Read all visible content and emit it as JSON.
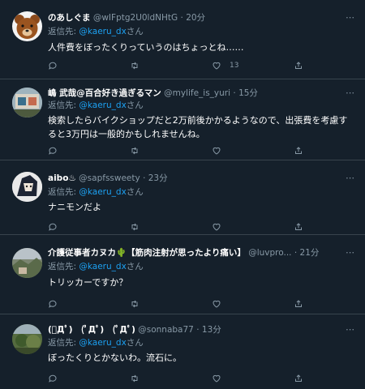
{
  "reply_label": "返信先:",
  "reply_suffix": "さん",
  "more_icon": "⋯",
  "colors": {
    "background": "#15202b",
    "muted": "#8899a6",
    "link": "#1da1f2",
    "divider": "#38444d"
  },
  "tweets": [
    {
      "name": "のあしぐま",
      "handle": "@wIFptg2U0ldNHtG",
      "sep": "·",
      "time": "20分",
      "reply_to": "@kaeru_dx",
      "text": "人件費をぼったくりっていうのはちょっとね……",
      "like_count": "13",
      "avatar_icon": "bear-avatar"
    },
    {
      "name": "嶋 武哉@百合好き過ぎるマン",
      "handle": "@mylife_is_yuri",
      "sep": "·",
      "time": "15分",
      "reply_to": "@kaeru_dx",
      "text": "検索したらバイクショップだと2万前後かかるようなので、出張費を考慮すると3万円は一般的かもしれませんね。",
      "like_count": "",
      "avatar_icon": "photo-avatar"
    },
    {
      "name": "aibo♨",
      "handle": "@sapfssweety",
      "sep": "·",
      "time": "23分",
      "reply_to": "@kaeru_dx",
      "text": "ナニモンだよ",
      "like_count": "",
      "avatar_icon": "character-avatar"
    },
    {
      "name": "介護従事者カヌカ🌵【筋肉注射が思ったより痛い】",
      "handle": "@luvpro...",
      "sep": "·",
      "time": "21分",
      "reply_to": "@kaeru_dx",
      "text": "トリッカーですか？",
      "like_count": "",
      "avatar_icon": "landscape-avatar"
    },
    {
      "name": "(ﾟДﾟ)　(ﾟДﾟ)　(ﾟДﾟ)",
      "handle": "@sonnaba77",
      "sep": "·",
      "time": "13分",
      "reply_to": "@kaeru_dx",
      "text": "ぼったくりとかないわ。流石に。",
      "like_count": "",
      "avatar_icon": "nature-avatar"
    }
  ]
}
